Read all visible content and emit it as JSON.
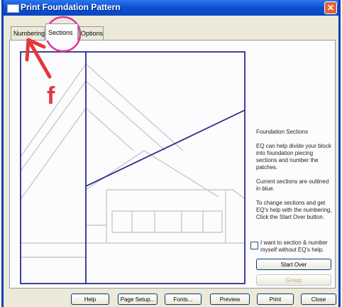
{
  "window": {
    "title": "Print Foundation Pattern",
    "close_glyph": "✕"
  },
  "tabs": [
    {
      "label": "Numbering",
      "active": false
    },
    {
      "label": "Sections",
      "active": true
    },
    {
      "label": "Options",
      "active": false
    }
  ],
  "info": {
    "heading": "Foundation Sections",
    "p1": "EQ can help divide your block into foundation piecing sections and number the patches.",
    "p2": "Current sections are outlined in blue.",
    "p3": "To change sections and get EQ's help with the numbering, Click the Start Over button."
  },
  "checkbox": {
    "label": "I want to section & number myself without EQ's help.",
    "checked": false
  },
  "side_buttons": {
    "start_over": "Start Over",
    "group": "Group"
  },
  "bottom_buttons": [
    "Help",
    "Page Setup...",
    "Fonts...",
    "Preview",
    "Print",
    "Close"
  ],
  "annotation": {
    "letter": "f",
    "color": "#e4373c",
    "circle_color": "#e0339a"
  },
  "colors": {
    "section_outline": "#2b2d8c",
    "pattern_line": "#c9c9c9"
  }
}
